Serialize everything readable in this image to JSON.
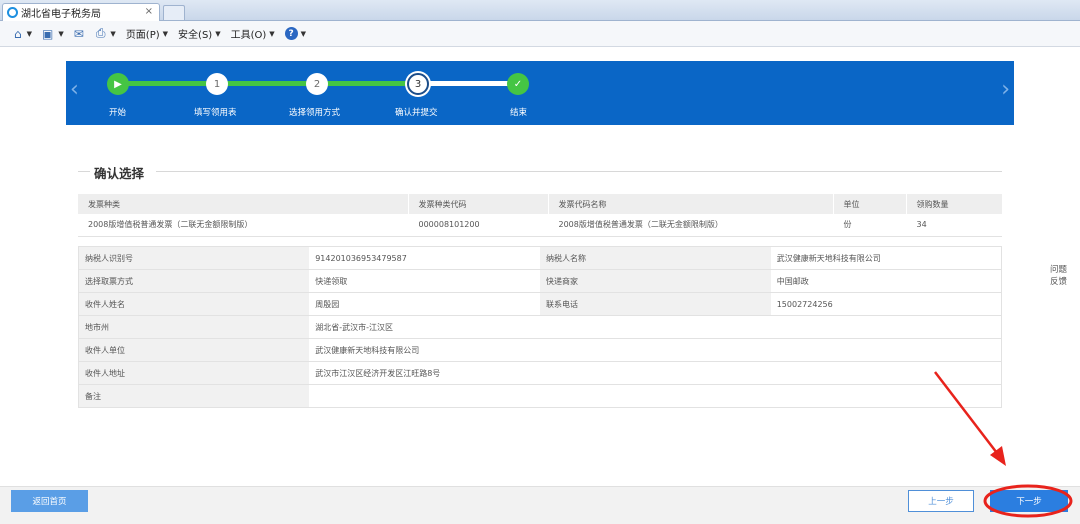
{
  "browser": {
    "tab_title": "湖北省电子税务局",
    "tab_close": "×",
    "toolbar": {
      "page_menu": "页面(P)",
      "safety_menu": "安全(S)",
      "tools_menu": "工具(O)",
      "help_icon": "?"
    }
  },
  "steps": [
    {
      "label": "开始",
      "state": "done",
      "mark": "▶"
    },
    {
      "label": "填写领用表",
      "state": "done",
      "mark": "1"
    },
    {
      "label": "选择领用方式",
      "state": "done",
      "mark": "2"
    },
    {
      "label": "确认并提交",
      "state": "current",
      "mark": "3"
    },
    {
      "label": "结束",
      "state": "done",
      "mark": "✓"
    }
  ],
  "section": {
    "title": "确认选择"
  },
  "invoice_table": {
    "headers": [
      "发票种类",
      "发票种类代码",
      "发票代码名称",
      "单位",
      "领购数量"
    ],
    "rows": [
      [
        "2008版增值税普通发票（二联无金额限制版）",
        "000008101200",
        "2008版增值税普通发票（二联无金额限制版）",
        "份",
        "34"
      ]
    ]
  },
  "details": {
    "taxpayer_id_label": "纳税人识别号",
    "taxpayer_id": "914201036953479587",
    "taxpayer_name_label": "纳税人名称",
    "taxpayer_name": "武汉健康新天地科技有限公司",
    "method_label": "选择取票方式",
    "method": "快递领取",
    "courier_label": "快递商家",
    "courier": "中国邮政",
    "recipient_name_label": "收件人姓名",
    "recipient_name": "周殷园",
    "phone_label": "联系电话",
    "phone": "15002724256",
    "region_label": "地市州",
    "region": "湖北省-武汉市-江汉区",
    "recipient_unit_label": "收件人单位",
    "recipient_unit": "武汉健康新天地科技有限公司",
    "recipient_address_label": "收件人地址",
    "recipient_address": "武汉市江汉区经济开发区江旺路8号",
    "note_label": "备注",
    "note": ""
  },
  "feedback": "问题反馈",
  "footer": {
    "home": "返回首页",
    "prev": "上一步",
    "next": "下一步"
  },
  "colors": {
    "banner": "#0a66c6",
    "step_done": "#45c544",
    "annotation": "#e8231c"
  }
}
